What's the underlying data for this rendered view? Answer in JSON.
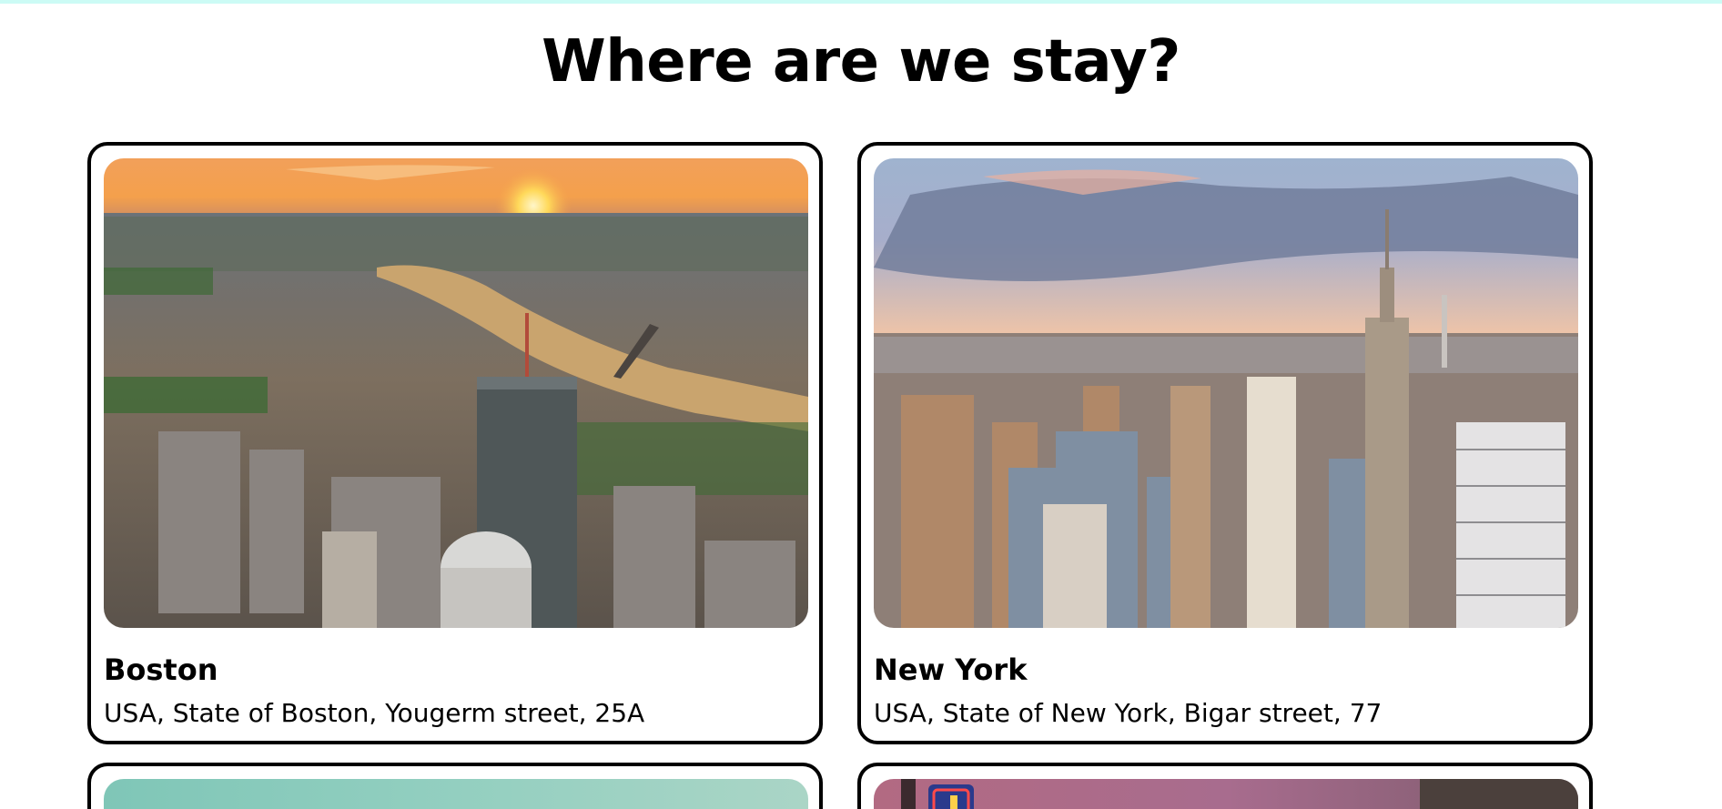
{
  "page": {
    "title": "Where are we stay?"
  },
  "cards": [
    {
      "city": "Boston",
      "address": "USA, State of Boston, Yougerm street, 25A",
      "image": "boston-aerial-sunset-photo"
    },
    {
      "city": "New York",
      "address": "USA, State of New York, Bigar street, 77",
      "image": "new-york-skyline-photo"
    },
    {
      "image": "teal-sky-photo"
    },
    {
      "image": "neon-sign-dusk-photo"
    }
  ],
  "colors": {
    "accent_bar": "#ccfbf5",
    "card_border": "#000000",
    "text": "#000000"
  }
}
